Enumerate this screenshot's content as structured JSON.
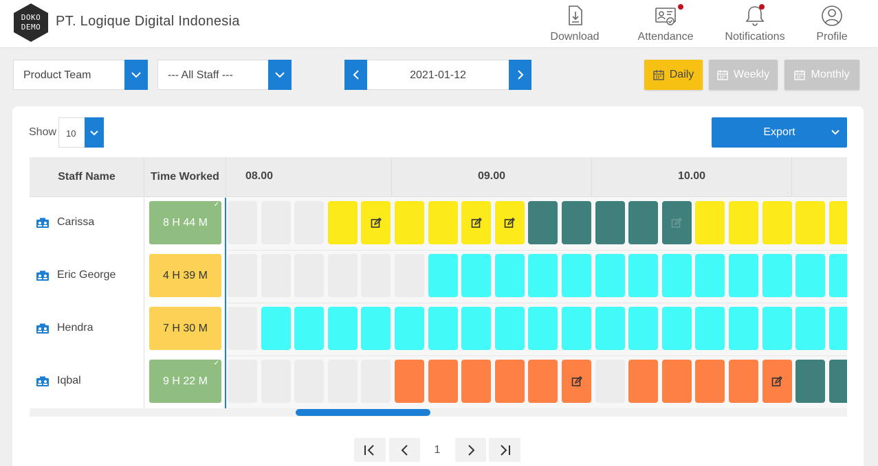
{
  "header": {
    "company": "PT. Logique Digital Indonesia",
    "logo_line1": "DOKO",
    "logo_line2": "DEMO",
    "nav": [
      {
        "label": "Download",
        "icon": "download-icon",
        "badge": false
      },
      {
        "label": "Attendance",
        "icon": "attendance-icon",
        "badge": true
      },
      {
        "label": "Notifications",
        "icon": "bell-icon",
        "badge": true
      },
      {
        "label": "Profile",
        "icon": "profile-icon",
        "badge": false
      }
    ]
  },
  "filters": {
    "team": "Product Team",
    "staff": "--- All Staff ---",
    "date": "2021-01-12",
    "views": [
      "Daily",
      "Weekly",
      "Monthly"
    ],
    "active_view": "Daily"
  },
  "table_controls": {
    "show_label": "Show",
    "show_value": "10",
    "export_label": "Export"
  },
  "table": {
    "col_staff": "Staff Name",
    "col_time": "Time Worked",
    "hours": [
      "08.00",
      "09.00",
      "10.00"
    ],
    "rows": [
      {
        "name": "Carissa",
        "time": "8 H 44 M",
        "badge": "green",
        "slots": [
          "e",
          "e",
          "e",
          "y",
          "ye",
          "y",
          "y",
          "ye",
          "ye",
          "t",
          "t",
          "t",
          "t",
          "te",
          "y",
          "y",
          "y",
          "y",
          "y"
        ]
      },
      {
        "name": "Eric George",
        "time": "4 H 39 M",
        "badge": "yellow",
        "slots": [
          "e",
          "e",
          "e",
          "e",
          "e",
          "e",
          "c",
          "c",
          "c",
          "c",
          "c",
          "c",
          "c",
          "c",
          "c",
          "c",
          "c",
          "c",
          "c"
        ]
      },
      {
        "name": "Hendra",
        "time": "7 H 30 M",
        "badge": "yellow",
        "slots": [
          "e",
          "c",
          "c",
          "c",
          "c",
          "c",
          "c",
          "c",
          "c",
          "c",
          "c",
          "c",
          "c",
          "c",
          "c",
          "c",
          "c",
          "c",
          "c"
        ]
      },
      {
        "name": "Iqbal",
        "time": "9 H 22 M",
        "badge": "green",
        "slots": [
          "e",
          "e",
          "e",
          "e",
          "e",
          "o",
          "o",
          "o",
          "o",
          "o",
          "oe",
          "e",
          "o",
          "o",
          "o",
          "o",
          "oe",
          "t",
          "t"
        ]
      }
    ]
  },
  "colors": {
    "empty": "#ececec",
    "yellow": "#fdea1b",
    "teal": "#3f7f7c",
    "cyan": "#42fbf9",
    "orange": "#fd8044",
    "primary": "#1c7fd6"
  },
  "pagination": {
    "current_page": "1"
  }
}
